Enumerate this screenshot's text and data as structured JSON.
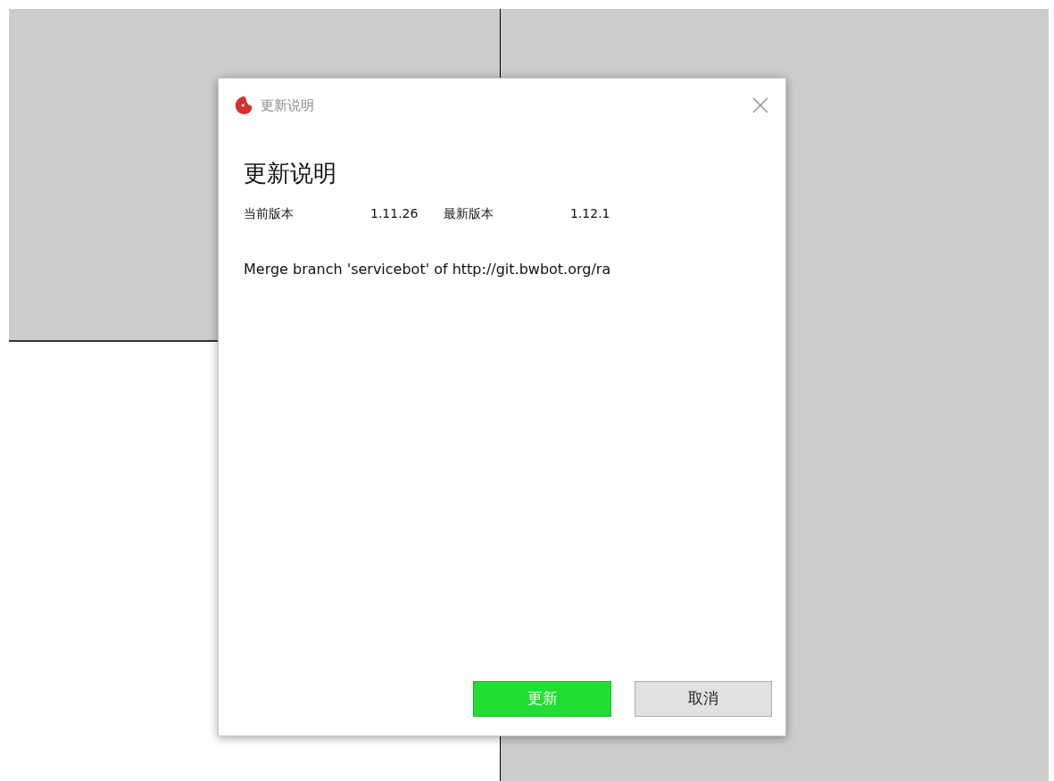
{
  "window": {
    "title": "更新说明"
  },
  "heading": "更新说明",
  "versions": [
    {
      "label": "当前版本",
      "value": "1.11.26"
    },
    {
      "label": "最新版本",
      "value": "1.12.1"
    }
  ],
  "message": "Merge branch 'servicebot' of http://git.bwbot.org/ra",
  "buttons": [
    {
      "kind": "primary",
      "label": "更新"
    },
    {
      "kind": "secondary",
      "label": "取消"
    }
  ]
}
